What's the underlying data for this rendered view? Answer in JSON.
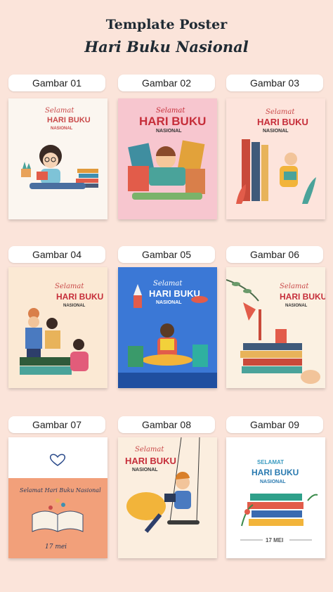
{
  "header": {
    "line1": "Template Poster",
    "line2": "Hari Buku Nasional"
  },
  "cards": [
    {
      "label": "Gambar 01",
      "script": "Selamat",
      "title": "HARI BUKU",
      "sub": "NASIONAL"
    },
    {
      "label": "Gambar 02",
      "script": "Selamat",
      "title": "HARI BUKU",
      "sub": "NASIONAL"
    },
    {
      "label": "Gambar 03",
      "script": "Selamat",
      "title": "HARI BUKU",
      "sub": "NASIONAL"
    },
    {
      "label": "Gambar 04",
      "script": "Selamat",
      "title": "HARI BUKU",
      "sub": "NASIONAL"
    },
    {
      "label": "Gambar 05",
      "script": "Selamat",
      "title": "HARI BUKU",
      "sub": "NASIONAL"
    },
    {
      "label": "Gambar 06",
      "script": "Selamat",
      "title": "HARI BUKU",
      "sub": "NASIONAL"
    },
    {
      "label": "Gambar 07",
      "script": "Selamat Hari Buku Nasional",
      "date": "17 mei"
    },
    {
      "label": "Gambar 08",
      "script": "Selamat",
      "title": "HARI BUKU",
      "sub": "NASIONAL"
    },
    {
      "label": "Gambar 09",
      "script": "SELAMAT",
      "title": "HARI BUKU",
      "sub": "NASIONAL",
      "date": "17 MEI"
    }
  ]
}
